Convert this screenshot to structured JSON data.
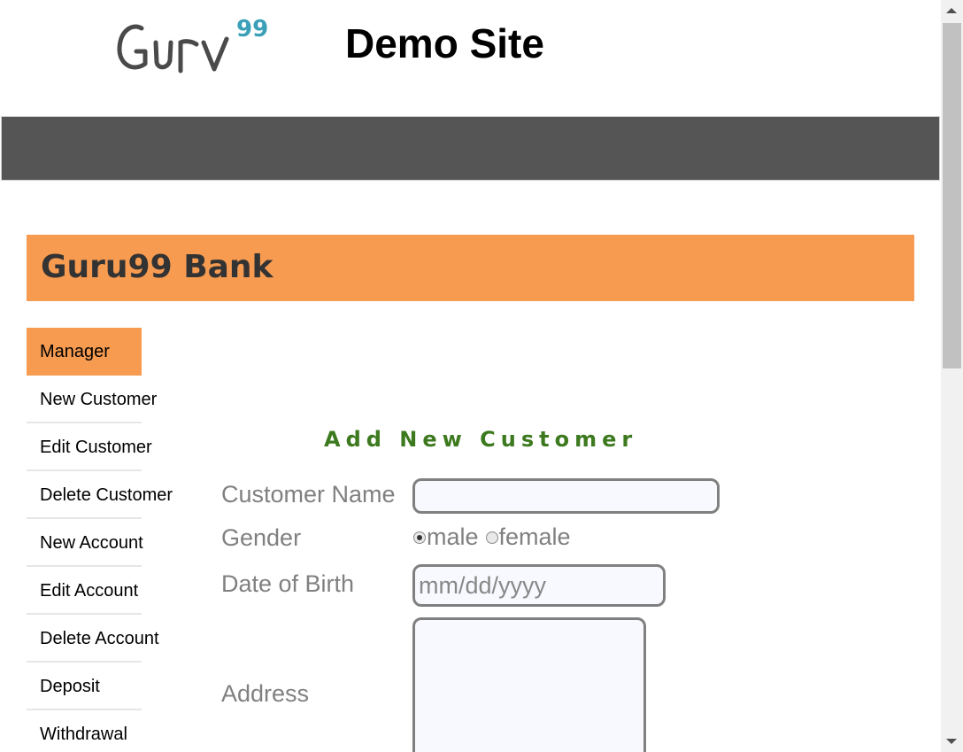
{
  "header": {
    "logo_text": "Guru99",
    "site_title": "Demo Site"
  },
  "bank": {
    "title": "Guru99 Bank"
  },
  "sidebar": {
    "items": [
      {
        "label": "Manager",
        "active": true
      },
      {
        "label": "New Customer"
      },
      {
        "label": "Edit Customer"
      },
      {
        "label": "Delete Customer"
      },
      {
        "label": "New Account"
      },
      {
        "label": "Edit Account"
      },
      {
        "label": "Delete Account"
      },
      {
        "label": "Deposit"
      },
      {
        "label": "Withdrawal"
      }
    ]
  },
  "form": {
    "heading": "Add New Customer",
    "customer_name_label": "Customer Name",
    "customer_name_value": "",
    "gender_label": "Gender",
    "gender_options": [
      "male",
      "female"
    ],
    "gender_selected": "male",
    "dob_label": "Date of Birth",
    "dob_placeholder": "mm/dd/yyyy",
    "address_label": "Address",
    "address_value": ""
  },
  "colors": {
    "accent": "#f79b51",
    "navbar": "#555555",
    "heading_green": "#3d7a1f",
    "logo_dark": "#4a4a4a",
    "logo_teal": "#3aa0b8"
  }
}
